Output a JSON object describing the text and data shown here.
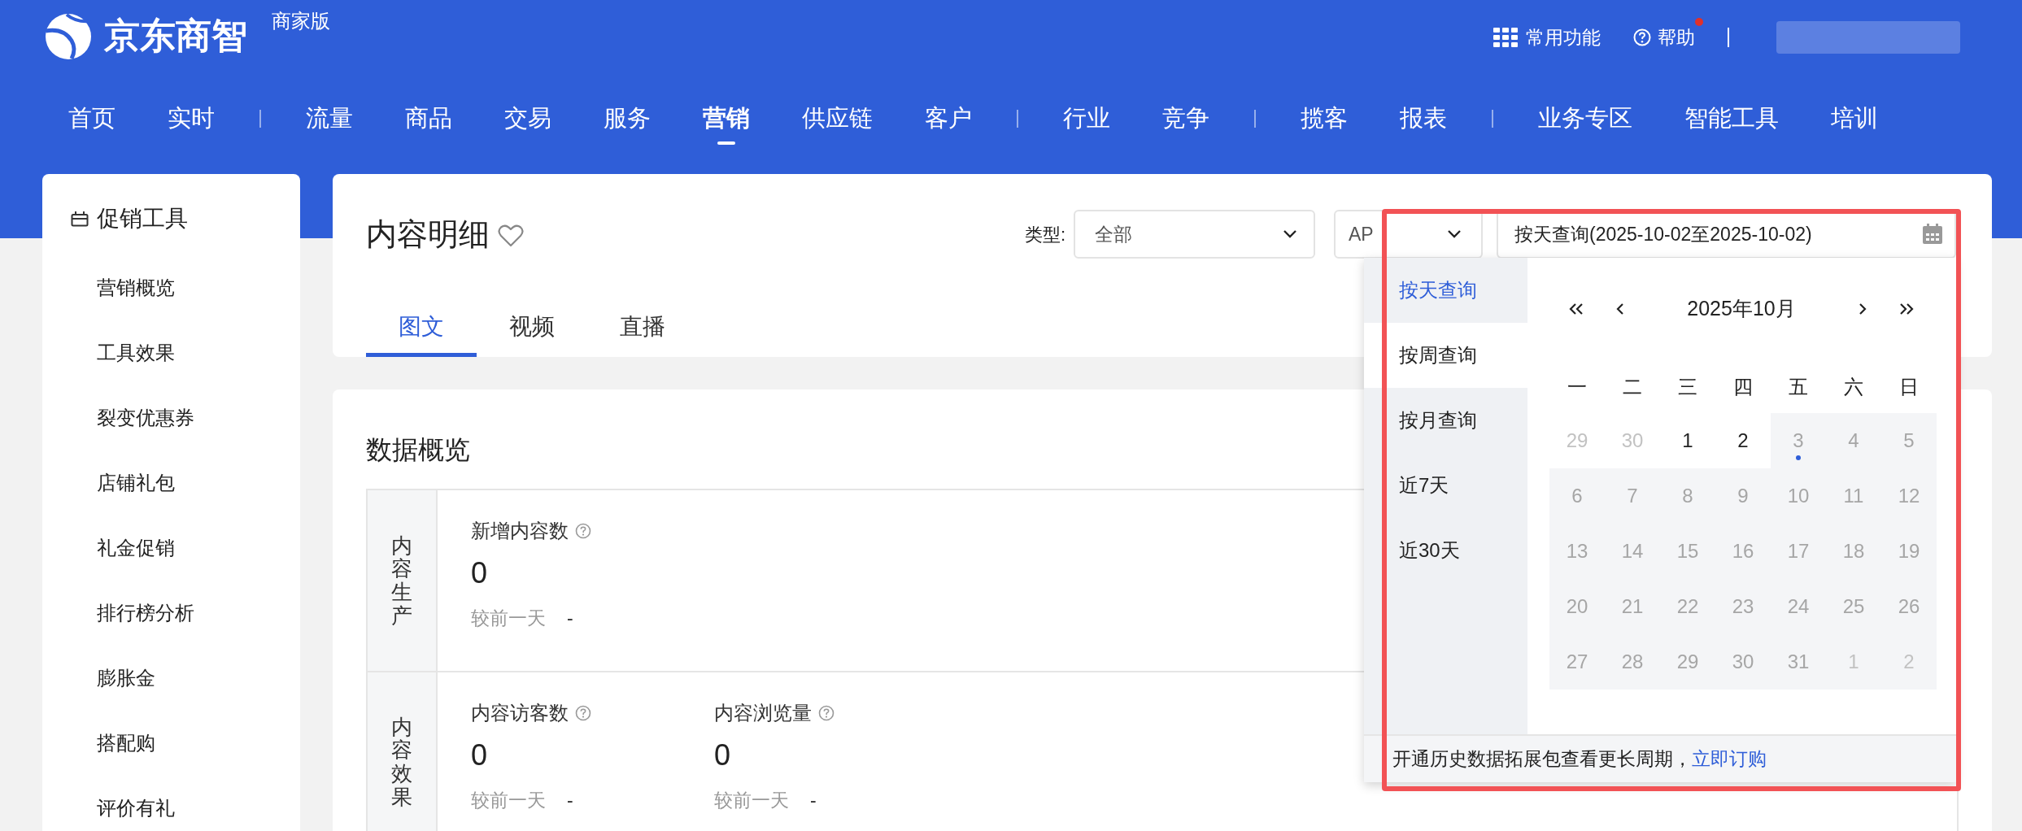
{
  "header": {
    "brand": "京东商智",
    "edition": "商家版",
    "quick_menu": "常用功能",
    "help": "帮助",
    "help_notice": true
  },
  "nav_groups": [
    [
      {
        "label": "首页",
        "selected": false
      },
      {
        "label": "实时",
        "selected": false
      }
    ],
    [
      {
        "label": "流量",
        "selected": false
      },
      {
        "label": "商品",
        "selected": false
      },
      {
        "label": "交易",
        "selected": false
      },
      {
        "label": "服务",
        "selected": false
      },
      {
        "label": "营销",
        "selected": true
      },
      {
        "label": "供应链",
        "selected": false
      },
      {
        "label": "客户",
        "selected": false
      }
    ],
    [
      {
        "label": "行业",
        "selected": false
      },
      {
        "label": "竞争",
        "selected": false
      }
    ],
    [
      {
        "label": "揽客",
        "selected": false
      },
      {
        "label": "报表",
        "selected": false
      }
    ],
    [
      {
        "label": "业务专区",
        "selected": false
      },
      {
        "label": "智能工具",
        "selected": false
      },
      {
        "label": "培训",
        "selected": false
      }
    ]
  ],
  "sidebar": {
    "title": "促销工具",
    "items": [
      {
        "label": "营销概览",
        "selected": false
      },
      {
        "label": "工具效果",
        "selected": false
      },
      {
        "label": "裂变优惠券",
        "selected": false
      },
      {
        "label": "店铺礼包",
        "selected": false
      },
      {
        "label": "礼金促销",
        "selected": false
      },
      {
        "label": "排行榜分析",
        "selected": false
      },
      {
        "label": "膨胀金",
        "selected": false
      },
      {
        "label": "搭配购",
        "selected": false
      },
      {
        "label": "评价有礼",
        "selected": false
      }
    ]
  },
  "page": {
    "title": "内容明细",
    "favorite": false,
    "filters": {
      "type_label": "类型:",
      "type_value": "全部",
      "channel_value": "AP",
      "date_value": "按天查询(2025-10-02至2025-10-02)"
    },
    "tabs": [
      {
        "label": "图文",
        "selected": true
      },
      {
        "label": "视频",
        "selected": false
      },
      {
        "label": "直播",
        "selected": false
      }
    ]
  },
  "overview": {
    "title": "数据概览",
    "sections": [
      {
        "title": "内容生产",
        "metrics": [
          {
            "label": "新增内容数",
            "value": "0",
            "compare_label": "较前一天",
            "compare_value": "-"
          }
        ]
      },
      {
        "title": "内容效果",
        "metrics": [
          {
            "label": "内容访客数",
            "value": "0",
            "compare_label": "较前一天",
            "compare_value": "-"
          },
          {
            "label": "内容浏览量",
            "value": "0",
            "compare_label": "较前一天",
            "compare_value": "-"
          }
        ]
      }
    ]
  },
  "date_popup": {
    "modes": [
      {
        "label": "按天查询",
        "selected": true,
        "hovered": false
      },
      {
        "label": "按周查询",
        "selected": false,
        "hovered": true
      },
      {
        "label": "按月查询",
        "selected": false,
        "hovered": false
      },
      {
        "label": "近7天",
        "selected": false,
        "hovered": false
      },
      {
        "label": "近30天",
        "selected": false,
        "hovered": false
      }
    ],
    "month": "2025年10月",
    "weekdays": [
      "一",
      "二",
      "三",
      "四",
      "五",
      "六",
      "日"
    ],
    "days": [
      {
        "day": "29",
        "outside": true,
        "disabled": false,
        "today": false
      },
      {
        "day": "30",
        "outside": true,
        "disabled": false,
        "today": false
      },
      {
        "day": "1",
        "outside": false,
        "disabled": false,
        "today": false
      },
      {
        "day": "2",
        "outside": false,
        "disabled": false,
        "today": false
      },
      {
        "day": "3",
        "outside": false,
        "disabled": true,
        "today": true
      },
      {
        "day": "4",
        "outside": false,
        "disabled": true,
        "today": false
      },
      {
        "day": "5",
        "outside": false,
        "disabled": true,
        "today": false
      },
      {
        "day": "6",
        "outside": false,
        "disabled": true,
        "today": false
      },
      {
        "day": "7",
        "outside": false,
        "disabled": true,
        "today": false
      },
      {
        "day": "8",
        "outside": false,
        "disabled": true,
        "today": false
      },
      {
        "day": "9",
        "outside": false,
        "disabled": true,
        "today": false
      },
      {
        "day": "10",
        "outside": false,
        "disabled": true,
        "today": false
      },
      {
        "day": "11",
        "outside": false,
        "disabled": true,
        "today": false
      },
      {
        "day": "12",
        "outside": false,
        "disabled": true,
        "today": false
      },
      {
        "day": "13",
        "outside": false,
        "disabled": true,
        "today": false
      },
      {
        "day": "14",
        "outside": false,
        "disabled": true,
        "today": false
      },
      {
        "day": "15",
        "outside": false,
        "disabled": true,
        "today": false
      },
      {
        "day": "16",
        "outside": false,
        "disabled": true,
        "today": false
      },
      {
        "day": "17",
        "outside": false,
        "disabled": true,
        "today": false
      },
      {
        "day": "18",
        "outside": false,
        "disabled": true,
        "today": false
      },
      {
        "day": "19",
        "outside": false,
        "disabled": true,
        "today": false
      },
      {
        "day": "20",
        "outside": false,
        "disabled": true,
        "today": false
      },
      {
        "day": "21",
        "outside": false,
        "disabled": true,
        "today": false
      },
      {
        "day": "22",
        "outside": false,
        "disabled": true,
        "today": false
      },
      {
        "day": "23",
        "outside": false,
        "disabled": true,
        "today": false
      },
      {
        "day": "24",
        "outside": false,
        "disabled": true,
        "today": false
      },
      {
        "day": "25",
        "outside": false,
        "disabled": true,
        "today": false
      },
      {
        "day": "26",
        "outside": false,
        "disabled": true,
        "today": false
      },
      {
        "day": "27",
        "outside": false,
        "disabled": true,
        "today": false
      },
      {
        "day": "28",
        "outside": false,
        "disabled": true,
        "today": false
      },
      {
        "day": "29",
        "outside": false,
        "disabled": true,
        "today": false
      },
      {
        "day": "30",
        "outside": false,
        "disabled": true,
        "today": false
      },
      {
        "day": "31",
        "outside": false,
        "disabled": true,
        "today": false
      },
      {
        "day": "1",
        "outside": true,
        "disabled": true,
        "today": false
      },
      {
        "day": "2",
        "outside": true,
        "disabled": true,
        "today": false
      }
    ],
    "footer_text": "开通历史数据拓展包查看更长周期，",
    "footer_link": "立即订购"
  }
}
